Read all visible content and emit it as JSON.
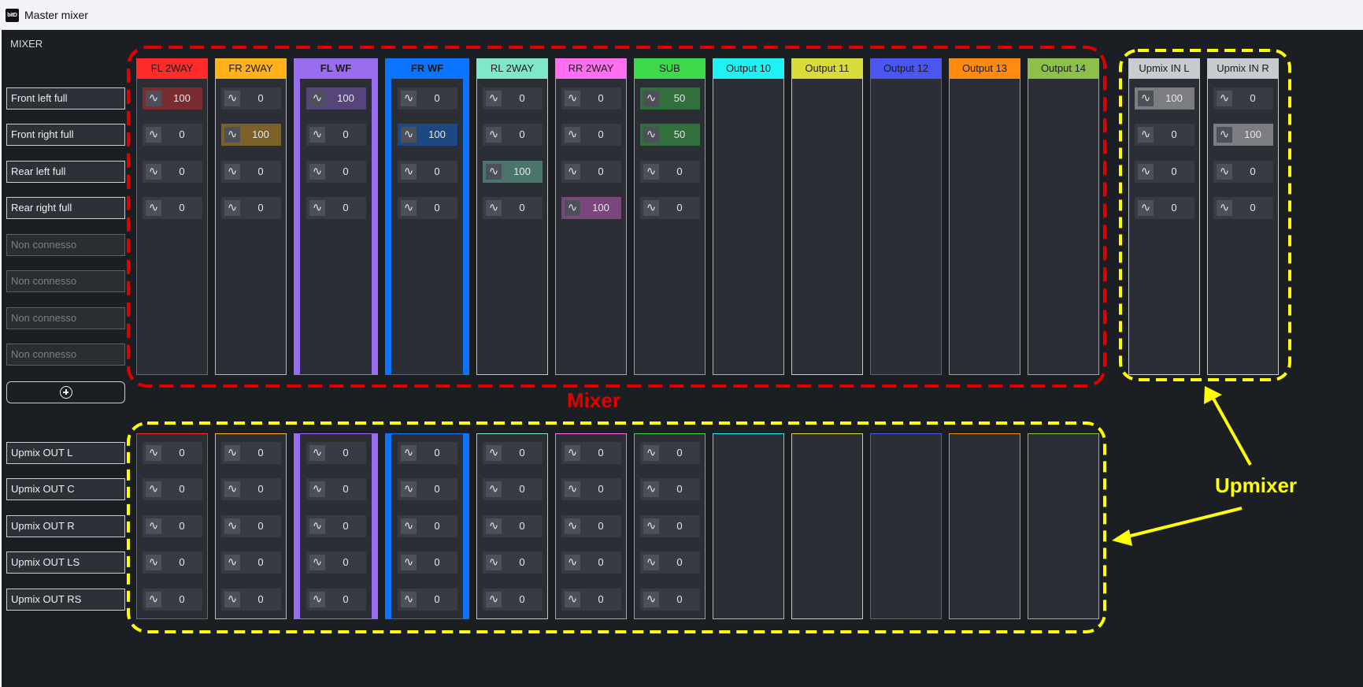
{
  "window": {
    "logo_text": "bitD",
    "title": "Master mixer"
  },
  "mixer_label": "MIXER",
  "mixer_inputs": [
    "Front left full",
    "Front right full",
    "Rear left full",
    "Rear right full",
    "Non connesso",
    "Non connesso",
    "Non connesso",
    "Non connesso"
  ],
  "upmix_inputs": [
    "Upmix OUT L",
    "Upmix OUT C",
    "Upmix OUT R",
    "Upmix OUT LS",
    "Upmix OUT RS"
  ],
  "wave_icon": "sine-wave-icon",
  "channels": [
    {
      "name": "FL 2WAY",
      "color": "#ff2a2a",
      "mixer": [
        "100",
        "0",
        "0",
        "0"
      ],
      "upmix": [
        "0",
        "0",
        "0",
        "0",
        "0"
      ],
      "active": 0
    },
    {
      "name": "FR 2WAY",
      "color": "#ffb21a",
      "mixer": [
        "0",
        "100",
        "0",
        "0"
      ],
      "upmix": [
        "0",
        "0",
        "0",
        "0",
        "0"
      ],
      "active": 1
    },
    {
      "name": "FL WF",
      "color": "#9a6cf0",
      "mixer": [
        "100",
        "0",
        "0",
        "0"
      ],
      "upmix": [
        "0",
        "0",
        "0",
        "0",
        "0"
      ],
      "active": 0
    },
    {
      "name": "FR WF",
      "color": "#0a74ff",
      "mixer": [
        "0",
        "100",
        "0",
        "0"
      ],
      "upmix": [
        "0",
        "0",
        "0",
        "0",
        "0"
      ],
      "active": 1
    },
    {
      "name": "RL 2WAY",
      "color": "#7fe8c8",
      "mixer": [
        "0",
        "0",
        "100",
        "0"
      ],
      "upmix": [
        "0",
        "0",
        "0",
        "0",
        "0"
      ],
      "active": 2
    },
    {
      "name": "RR 2WAY",
      "color": "#ff6ef0",
      "mixer": [
        "0",
        "0",
        "0",
        "100"
      ],
      "upmix": [
        "0",
        "0",
        "0",
        "0",
        "0"
      ],
      "active": 3
    },
    {
      "name": "SUB",
      "color": "#3ed94a",
      "mixer": [
        "50",
        "50",
        "0",
        "0"
      ],
      "upmix": [
        "0",
        "0",
        "0",
        "0",
        "0"
      ],
      "active": [
        0,
        1
      ]
    },
    {
      "name": "Output 10",
      "color": "#1ef2f2",
      "mixer": [],
      "upmix": []
    },
    {
      "name": "Output 11",
      "color": "#d8dc3a",
      "mixer": [],
      "upmix": []
    },
    {
      "name": "Output 12",
      "color": "#4a56ef",
      "mixer": [],
      "upmix": []
    },
    {
      "name": "Output 13",
      "color": "#ff8a12",
      "mixer": [],
      "upmix": []
    },
    {
      "name": "Output 14",
      "color": "#8cc04a",
      "mixer": [],
      "upmix": []
    }
  ],
  "upmix_in": [
    {
      "name": "Upmix IN L",
      "color": "#c8cbd0",
      "values": [
        "100",
        "0",
        "0",
        "0"
      ],
      "active": 0
    },
    {
      "name": "Upmix IN R",
      "color": "#c8cbd0",
      "values": [
        "0",
        "100",
        "0",
        "0"
      ],
      "active": 1
    }
  ],
  "annotations": {
    "mixer": "Mixer",
    "upmixer": "Upmixer",
    "mixer_color": "#e00000",
    "upmixer_color": "#ffff00"
  }
}
